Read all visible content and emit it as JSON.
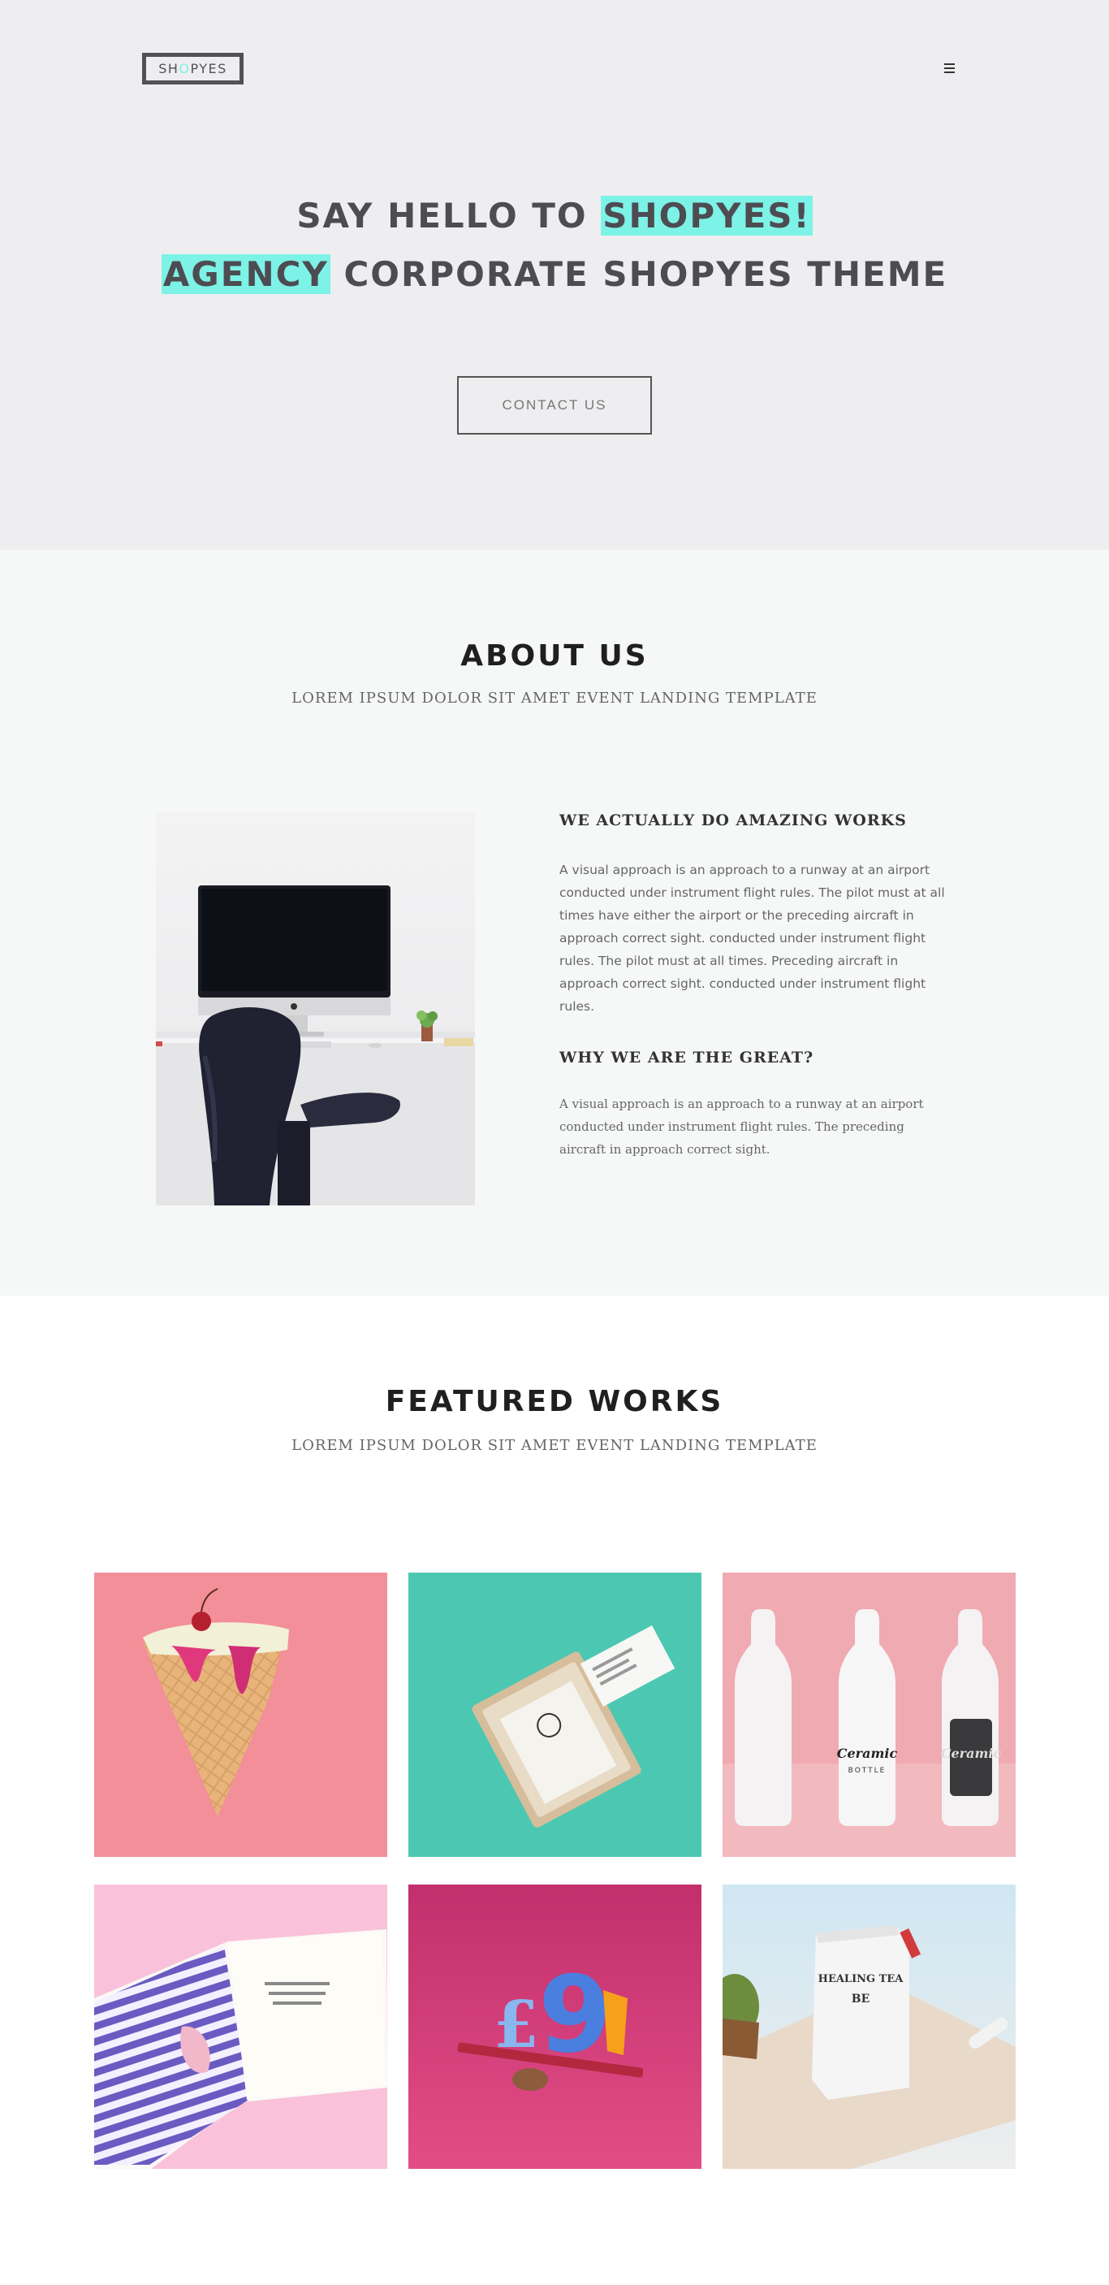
{
  "header": {
    "logo_parts": [
      "SH",
      "O",
      "PYES"
    ],
    "menu_icon": "hamburger-menu-icon"
  },
  "hero": {
    "line1_prefix": "SAY HELLO TO",
    "line1_highlight": "SHOPYES!",
    "line2_highlight": "AGENCY",
    "line2_suffix": "CORPORATE SHOPYES THEME",
    "cta_label": "CONTACT US",
    "highlight_color": "#7df2e6"
  },
  "about": {
    "title": "ABOUT US",
    "subtitle": "LOREM IPSUM DOLOR SIT AMET EVENT LANDING TEMPLATE",
    "image": "workspace-desk-photo",
    "heading1": "WE ACTUALLY DO AMAZING WORKS",
    "paragraph1": "A visual approach is an approach to a runway at an airport conducted under instrument flight rules. The pilot must at all times have either the airport or the preceding aircraft in approach correct sight. conducted under instrument flight rules. The pilot must at all times. Preceding aircraft in approach correct sight. conducted under instrument flight rules.",
    "heading2": "WHY WE ARE THE GREAT?",
    "paragraph2": "A visual approach is an approach to a runway at an airport conducted under instrument flight rules. The preceding aircraft in approach correct sight."
  },
  "works": {
    "title": "FEATURED WORKS",
    "subtitle": "LOREM IPSUM DOLOR SIT AMET EVENT LANDING TEMPLATE",
    "items": [
      {
        "name": "ice-cream-cake",
        "bg": "#f28f99"
      },
      {
        "name": "business-cards",
        "bg": "#4cc8b2"
      },
      {
        "name": "ceramic-bottles",
        "bg": "#f0aab1",
        "bottle_text": [
          "Ceramic",
          "BOTTLE"
        ]
      },
      {
        "name": "striped-magazine",
        "bg": "#f9c2da"
      },
      {
        "name": "pound-nine-figures",
        "bg": "#cc3b72",
        "glyphs": [
          "£",
          "9"
        ]
      },
      {
        "name": "healing-tea-bag",
        "bg": "#d3e8f0",
        "bag_text": [
          "HEALING TEA",
          "BE"
        ]
      }
    ]
  }
}
